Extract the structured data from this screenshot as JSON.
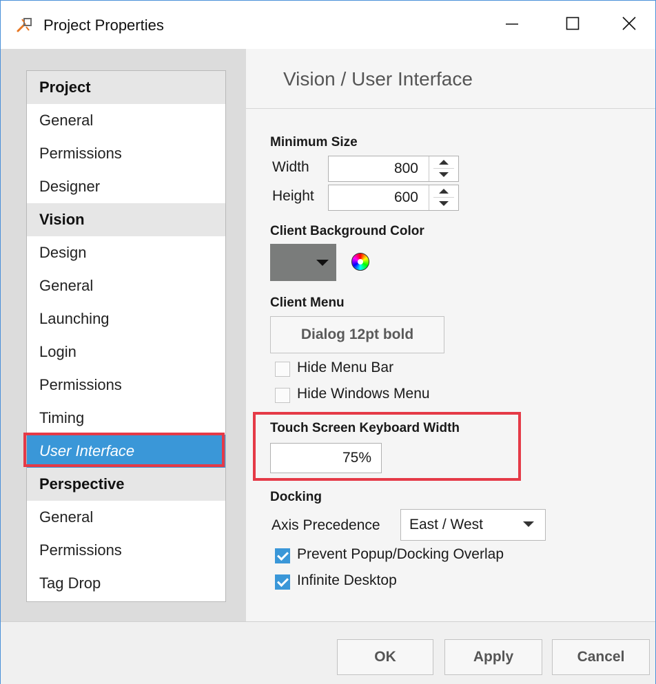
{
  "window": {
    "title": "Project Properties",
    "icon": "ignition-logo-icon",
    "controls": {
      "minimize": "minimize-icon",
      "maximize": "maximize-icon",
      "close": "close-icon"
    }
  },
  "tree": {
    "groups": [
      {
        "label": "Project",
        "items": [
          "General",
          "Permissions",
          "Designer"
        ]
      },
      {
        "label": "Vision",
        "items": [
          "Design",
          "General",
          "Launching",
          "Login",
          "Permissions",
          "Timing",
          "User Interface"
        ]
      },
      {
        "label": "Perspective",
        "items": [
          "General",
          "Permissions",
          "Tag Drop"
        ]
      }
    ],
    "selected": "User Interface"
  },
  "section": {
    "title": "Vision / User Interface"
  },
  "min_size": {
    "heading": "Minimum Size",
    "width_label": "Width",
    "width_value": "800",
    "height_label": "Height",
    "height_value": "600"
  },
  "client_bg": {
    "heading": "Client Background Color",
    "color": "#7a7c7b"
  },
  "client_menu": {
    "heading": "Client Menu",
    "font_button": "Dialog 12pt bold",
    "hide_menu_bar": {
      "label": "Hide Menu Bar",
      "checked": false
    },
    "hide_windows_menu": {
      "label": "Hide Windows Menu",
      "checked": false
    }
  },
  "touch_keyboard": {
    "heading": "Touch Screen Keyboard Width",
    "value": "75%"
  },
  "docking": {
    "heading": "Docking",
    "axis_label": "Axis Precedence",
    "axis_value": "East / West",
    "prevent_overlap": {
      "label": "Prevent Popup/Docking Overlap",
      "checked": true
    },
    "infinite_desktop": {
      "label": "Infinite Desktop",
      "checked": true
    }
  },
  "footer": {
    "ok": "OK",
    "apply": "Apply",
    "cancel": "Cancel"
  },
  "colors": {
    "accent": "#3a97d8",
    "highlight": "#e53a47"
  }
}
